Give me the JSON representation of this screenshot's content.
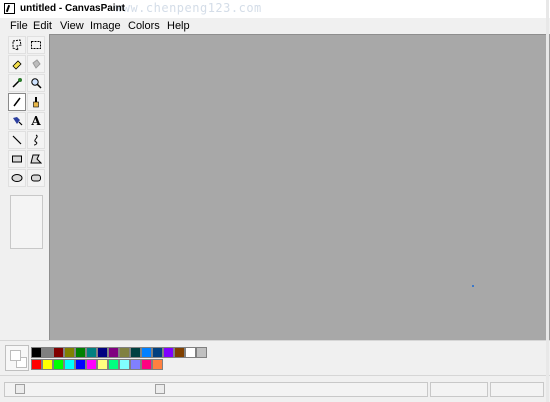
{
  "window": {
    "title": "untitled - CanvasPaint",
    "watermark": "www.chenpeng123.com"
  },
  "menu": {
    "items": [
      {
        "label": "File"
      },
      {
        "label": "Edit"
      },
      {
        "label": "View"
      },
      {
        "label": "Image"
      },
      {
        "label": "Colors"
      },
      {
        "label": "Help"
      }
    ]
  },
  "toolbox": {
    "tools": [
      {
        "name": "free-select-icon",
        "glyph": "",
        "pressed": false
      },
      {
        "name": "rect-select-icon",
        "glyph": "",
        "pressed": false
      },
      {
        "name": "eraser-icon",
        "glyph": "",
        "pressed": false
      },
      {
        "name": "fill-bucket-icon",
        "glyph": "",
        "pressed": false
      },
      {
        "name": "color-picker-icon",
        "glyph": "",
        "pressed": false
      },
      {
        "name": "magnifier-icon",
        "glyph": "",
        "pressed": false
      },
      {
        "name": "pencil-icon",
        "glyph": "",
        "pressed": true
      },
      {
        "name": "brush-icon",
        "glyph": "",
        "pressed": false
      },
      {
        "name": "airbrush-icon",
        "glyph": "",
        "pressed": false
      },
      {
        "name": "text-icon",
        "glyph": "A",
        "pressed": false
      },
      {
        "name": "line-icon",
        "glyph": "",
        "pressed": false
      },
      {
        "name": "curve-icon",
        "glyph": "",
        "pressed": false
      },
      {
        "name": "rectangle-icon",
        "glyph": "",
        "pressed": false
      },
      {
        "name": "polygon-icon",
        "glyph": "",
        "pressed": false
      },
      {
        "name": "ellipse-icon",
        "glyph": "",
        "pressed": false
      },
      {
        "name": "rounded-rectangle-icon",
        "glyph": "",
        "pressed": false
      }
    ]
  },
  "palette": {
    "foreground": "#ffffff",
    "background": "#ffffff",
    "row1": [
      "#000000",
      "#808080",
      "#800000",
      "#808000",
      "#008000",
      "#008080",
      "#000080",
      "#800080",
      "#808040",
      "#004040",
      "#0080ff",
      "#004080",
      "#8000ff",
      "#804000",
      "#ffffff",
      "#c0c0c0"
    ],
    "row2": [
      "#ff0000",
      "#ffff00",
      "#00ff00",
      "#00ffff",
      "#0000ff",
      "#ff00ff",
      "#ffff80",
      "#00ff80",
      "#80ffff",
      "#8080ff",
      "#ff0080",
      "#ff8040"
    ]
  },
  "canvas": {
    "background": "#a8a8a8"
  }
}
